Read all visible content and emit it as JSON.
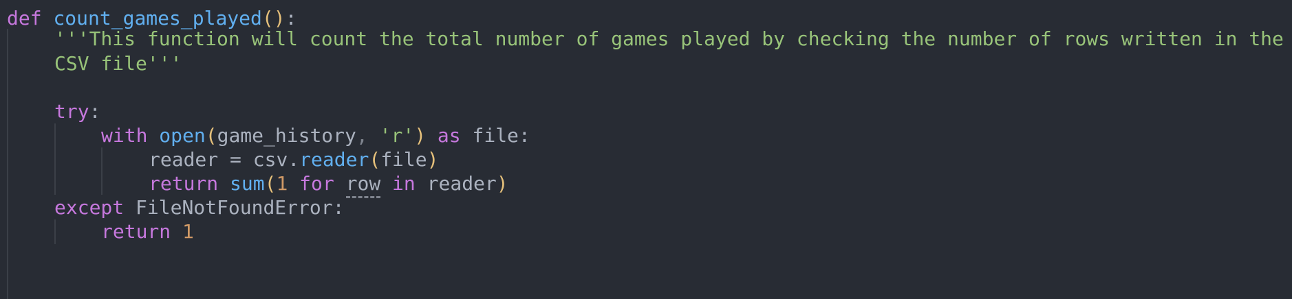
{
  "code": {
    "def_kw": "def",
    "func_name": "count_games_played",
    "def_parens": "()",
    "def_colon": ":",
    "docstring_line1": "'''This function will count the total number of games played by checking the number of rows written in the",
    "docstring_line2": "CSV file'''",
    "try_kw": "try",
    "try_colon": ":",
    "with_kw": "with",
    "open_fn": "open",
    "open_paren_l": "(",
    "game_history": "game_history",
    "comma": ",",
    "mode_str": "'r'",
    "open_paren_r": ")",
    "as_kw": "as",
    "file_var": "file",
    "with_colon": ":",
    "reader_var": "reader",
    "assign": "=",
    "csv_mod": "csv",
    "dot": ".",
    "reader_fn": "reader",
    "reader_paren_l": "(",
    "reader_arg": "file",
    "reader_paren_r": ")",
    "return_kw": "return",
    "sum_fn": "sum",
    "sum_paren_l": "(",
    "one": "1",
    "for_kw": "for",
    "row_var": "row",
    "in_kw": "in",
    "reader_iter": "reader",
    "sum_paren_r": ")",
    "except_kw": "except",
    "exception_name": "FileNotFoundError",
    "except_colon": ":",
    "return_kw2": "return",
    "return_value": "1"
  }
}
